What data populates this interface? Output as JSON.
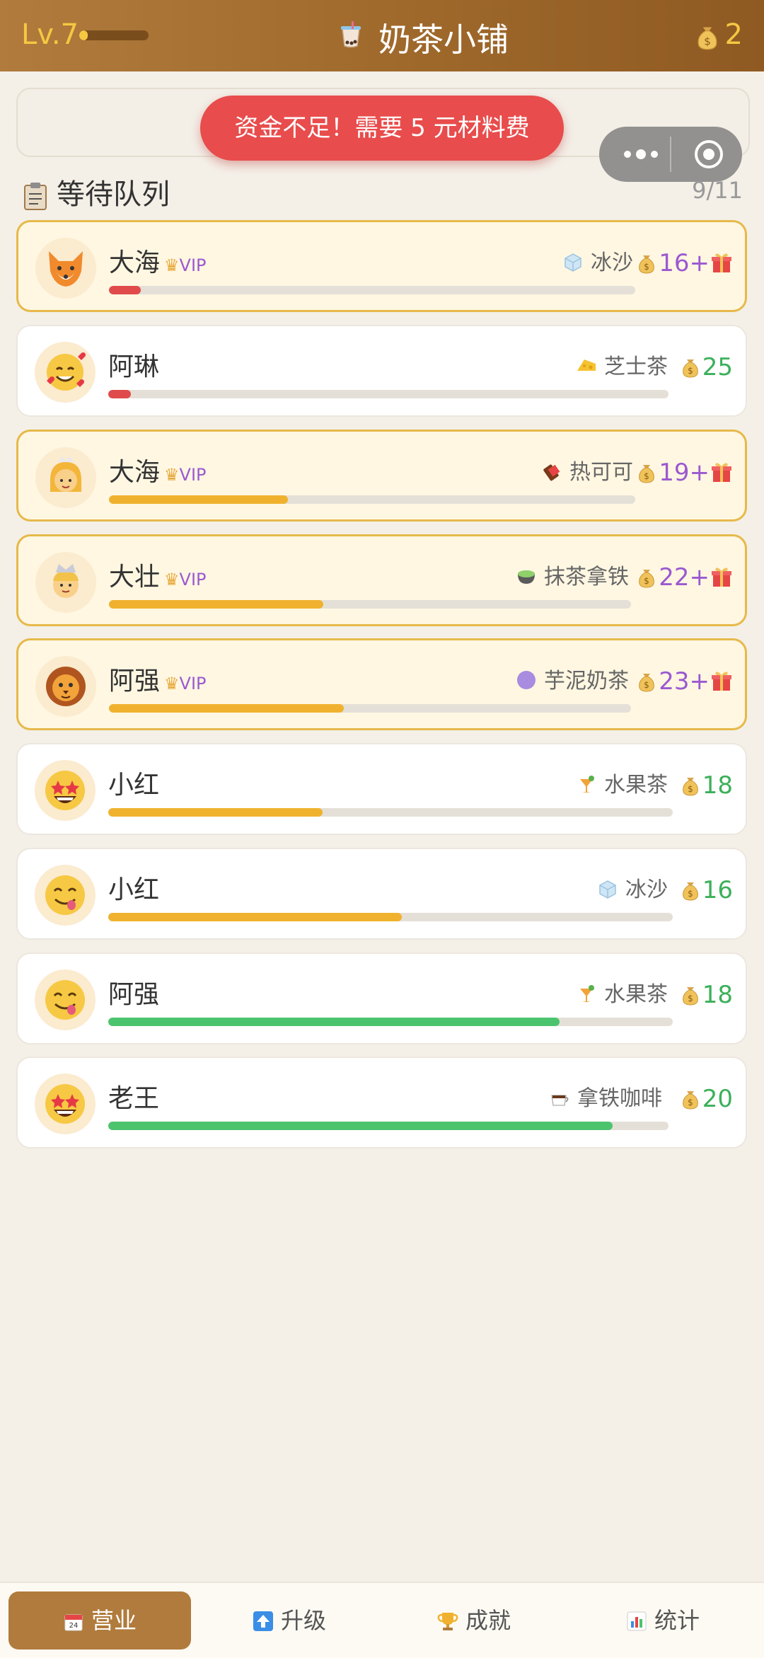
{
  "header": {
    "level": "Lv.7",
    "level_progress": 0.12,
    "title": "奶茶小铺",
    "coins": "2"
  },
  "toast": "资金不足！需要 5 元材料费",
  "queue": {
    "title": "等待队列",
    "count": "9/11"
  },
  "vip_label": "VIP",
  "customers": [
    {
      "name": "大海",
      "vip": true,
      "avatar": "fox-avatar-icon",
      "drink": "冰沙",
      "drink_icon": "ice-icon",
      "price": "16+",
      "progress": 0.06,
      "bar_color": "#e04a4a"
    },
    {
      "name": "阿琳",
      "vip": false,
      "avatar": "heart-smile-avatar-icon",
      "drink": "芝士茶",
      "drink_icon": "cheese-icon",
      "price": "25",
      "progress": 0.04,
      "bar_color": "#e04a4a"
    },
    {
      "name": "大海",
      "vip": true,
      "avatar": "princess-avatar-icon",
      "drink": "热可可",
      "drink_icon": "chocolate-icon",
      "price": "19+",
      "progress": 0.34,
      "bar_color": "#f0b22e"
    },
    {
      "name": "大壮",
      "vip": true,
      "avatar": "prince-avatar-icon",
      "drink": "抹茶拿铁",
      "drink_icon": "matcha-icon",
      "price": "22+",
      "progress": 0.41,
      "bar_color": "#f0b22e"
    },
    {
      "name": "阿强",
      "vip": true,
      "avatar": "lion-avatar-icon",
      "drink": "芋泥奶茶",
      "drink_icon": "taro-icon",
      "price": "23+",
      "progress": 0.45,
      "bar_color": "#f0b22e"
    },
    {
      "name": "小红",
      "vip": false,
      "avatar": "star-eyes-avatar-icon",
      "drink": "水果茶",
      "drink_icon": "fruit-drink-icon",
      "price": "18",
      "progress": 0.38,
      "bar_color": "#f0b22e"
    },
    {
      "name": "小红",
      "vip": false,
      "avatar": "yum-avatar-icon",
      "drink": "冰沙",
      "drink_icon": "ice-icon",
      "price": "16",
      "progress": 0.52,
      "bar_color": "#f0b22e"
    },
    {
      "name": "阿强",
      "vip": false,
      "avatar": "yum-avatar-icon",
      "drink": "水果茶",
      "drink_icon": "fruit-drink-icon",
      "price": "18",
      "progress": 0.8,
      "bar_color": "#4cc46e"
    },
    {
      "name": "老王",
      "vip": false,
      "avatar": "star-eyes-avatar-icon",
      "drink": "拿铁咖啡",
      "drink_icon": "coffee-icon",
      "price": "20",
      "progress": 0.9,
      "bar_color": "#4cc46e"
    }
  ],
  "nav": [
    {
      "label": "营业",
      "icon": "shop-icon",
      "active": true
    },
    {
      "label": "升级",
      "icon": "upgrade-arrow-icon",
      "active": false
    },
    {
      "label": "成就",
      "icon": "trophy-icon",
      "active": false
    },
    {
      "label": "统计",
      "icon": "chart-icon",
      "active": false
    }
  ]
}
